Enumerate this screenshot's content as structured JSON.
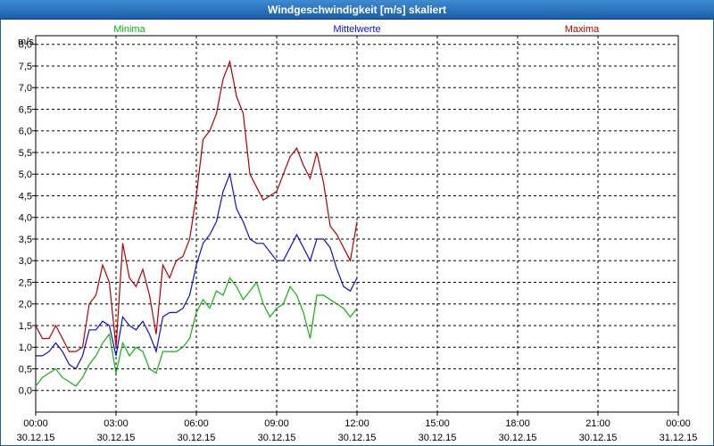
{
  "window": {
    "title": "Windgeschwindigkeit [m/s] skaliert"
  },
  "colors": {
    "minima": "#10b010",
    "mittel": "#1010c0",
    "maxima": "#b00000",
    "grid": "#000000"
  },
  "chart_data": {
    "type": "line",
    "title": "Windgeschwindigkeit [m/s] skaliert",
    "ylabel": "m/s",
    "xlabel": "",
    "ylim": [
      -0.5,
      8.2
    ],
    "xlim_hours": [
      0,
      48
    ],
    "grid": true,
    "legend_placement": "top",
    "y_ticks": [
      "0,0",
      "0,5",
      "1,0",
      "1,5",
      "2,0",
      "2,5",
      "3,0",
      "3,5",
      "4,0",
      "4,5",
      "5,0",
      "5,5",
      "6,0",
      "6,5",
      "7,0",
      "7,5",
      "8,0"
    ],
    "x_ticks": [
      {
        "time": "00:00",
        "date": "30.12.15"
      },
      {
        "time": "03:00",
        "date": "30.12.15"
      },
      {
        "time": "06:00",
        "date": "30.12.15"
      },
      {
        "time": "09:00",
        "date": "30.12.15"
      },
      {
        "time": "12:00",
        "date": "30.12.15"
      },
      {
        "time": "15:00",
        "date": "30.12.15"
      },
      {
        "time": "18:00",
        "date": "30.12.15"
      },
      {
        "time": "21:00",
        "date": "30.12.15"
      },
      {
        "time": "00:00",
        "date": "31.12.15"
      }
    ],
    "series": [
      {
        "name": "Minima",
        "color": "#10b010",
        "points": [
          [
            0,
            0.1
          ],
          [
            0.5,
            0.3
          ],
          [
            1,
            0.4
          ],
          [
            1.5,
            0.5
          ],
          [
            2,
            0.3
          ],
          [
            2.5,
            0.2
          ],
          [
            3,
            0.1
          ],
          [
            3.5,
            0.3
          ],
          [
            4,
            0.6
          ],
          [
            4.5,
            0.8
          ],
          [
            5,
            1.1
          ],
          [
            5.5,
            1.3
          ],
          [
            6,
            0.4
          ],
          [
            6.5,
            1.1
          ],
          [
            7,
            0.8
          ],
          [
            7.5,
            1.0
          ],
          [
            8,
            0.9
          ],
          [
            8.5,
            0.5
          ],
          [
            9,
            0.4
          ],
          [
            9.5,
            0.9
          ],
          [
            10,
            0.9
          ],
          [
            10.5,
            0.9
          ],
          [
            11,
            1.0
          ],
          [
            11.5,
            1.2
          ],
          [
            12,
            1.8
          ],
          [
            12.5,
            2.1
          ],
          [
            13,
            1.9
          ],
          [
            13.5,
            2.3
          ],
          [
            14,
            2.2
          ],
          [
            14.5,
            2.6
          ],
          [
            15,
            2.4
          ],
          [
            15.5,
            2.1
          ],
          [
            16,
            2.3
          ],
          [
            16.5,
            2.5
          ],
          [
            17,
            2.0
          ],
          [
            17.5,
            1.7
          ],
          [
            18,
            1.9
          ],
          [
            18.5,
            2.0
          ],
          [
            19,
            2.4
          ],
          [
            19.5,
            2.2
          ],
          [
            20,
            1.8
          ],
          [
            20.5,
            1.2
          ],
          [
            21,
            2.2
          ],
          [
            21.5,
            2.2
          ],
          [
            22,
            2.1
          ],
          [
            22.5,
            2.0
          ],
          [
            23,
            1.9
          ],
          [
            23.5,
            1.7
          ],
          [
            24,
            1.9
          ]
        ]
      },
      {
        "name": "Mittelwerte",
        "color": "#1010c0",
        "points": [
          [
            0,
            0.8
          ],
          [
            0.5,
            0.8
          ],
          [
            1,
            0.9
          ],
          [
            1.5,
            1.1
          ],
          [
            2,
            0.9
          ],
          [
            2.5,
            0.6
          ],
          [
            3,
            0.5
          ],
          [
            3.5,
            0.8
          ],
          [
            4,
            1.4
          ],
          [
            4.5,
            1.4
          ],
          [
            5,
            1.6
          ],
          [
            5.5,
            1.5
          ],
          [
            6,
            0.8
          ],
          [
            6.5,
            1.7
          ],
          [
            7,
            1.5
          ],
          [
            7.5,
            1.4
          ],
          [
            8,
            1.6
          ],
          [
            8.5,
            1.3
          ],
          [
            9,
            0.9
          ],
          [
            9.5,
            1.7
          ],
          [
            10,
            1.8
          ],
          [
            10.5,
            1.8
          ],
          [
            11,
            1.9
          ],
          [
            11.5,
            2.2
          ],
          [
            12,
            2.9
          ],
          [
            12.5,
            3.4
          ],
          [
            13,
            3.6
          ],
          [
            13.5,
            3.9
          ],
          [
            14,
            4.6
          ],
          [
            14.5,
            5.0
          ],
          [
            15,
            4.2
          ],
          [
            15.5,
            3.9
          ],
          [
            16,
            3.5
          ],
          [
            16.5,
            3.4
          ],
          [
            17,
            3.4
          ],
          [
            17.5,
            3.2
          ],
          [
            18,
            3.0
          ],
          [
            18.5,
            3.0
          ],
          [
            19,
            3.3
          ],
          [
            19.5,
            3.6
          ],
          [
            20,
            3.3
          ],
          [
            20.5,
            3.0
          ],
          [
            21,
            3.5
          ],
          [
            21.5,
            3.5
          ],
          [
            22,
            3.3
          ],
          [
            22.5,
            2.8
          ],
          [
            23,
            2.4
          ],
          [
            23.5,
            2.3
          ],
          [
            24,
            2.6
          ]
        ]
      },
      {
        "name": "Maxima",
        "color": "#b00000",
        "points": [
          [
            0,
            1.5
          ],
          [
            0.5,
            1.2
          ],
          [
            1,
            1.2
          ],
          [
            1.5,
            1.5
          ],
          [
            2,
            1.2
          ],
          [
            2.5,
            0.9
          ],
          [
            3,
            0.9
          ],
          [
            3.5,
            1.0
          ],
          [
            4,
            2.0
          ],
          [
            4.5,
            2.2
          ],
          [
            5,
            2.9
          ],
          [
            5.5,
            2.5
          ],
          [
            6,
            1.0
          ],
          [
            6.5,
            3.4
          ],
          [
            7,
            2.6
          ],
          [
            7.5,
            2.4
          ],
          [
            8,
            2.8
          ],
          [
            8.5,
            2.2
          ],
          [
            9,
            1.3
          ],
          [
            9.5,
            2.9
          ],
          [
            10,
            2.6
          ],
          [
            10.5,
            3.0
          ],
          [
            11,
            3.1
          ],
          [
            11.5,
            3.5
          ],
          [
            12,
            4.5
          ],
          [
            12.5,
            5.8
          ],
          [
            13,
            6.0
          ],
          [
            13.5,
            6.4
          ],
          [
            14,
            7.2
          ],
          [
            14.5,
            7.6
          ],
          [
            15,
            6.8
          ],
          [
            15.5,
            6.4
          ],
          [
            16,
            5.0
          ],
          [
            16.5,
            4.7
          ],
          [
            17,
            4.4
          ],
          [
            17.5,
            4.5
          ],
          [
            18,
            4.6
          ],
          [
            18.5,
            5.0
          ],
          [
            19,
            5.4
          ],
          [
            19.5,
            5.6
          ],
          [
            20,
            5.2
          ],
          [
            20.5,
            4.9
          ],
          [
            21,
            5.5
          ],
          [
            21.5,
            4.8
          ],
          [
            22,
            3.8
          ],
          [
            22.5,
            3.6
          ],
          [
            23,
            3.3
          ],
          [
            23.5,
            3.0
          ],
          [
            24,
            3.9
          ]
        ]
      }
    ]
  }
}
